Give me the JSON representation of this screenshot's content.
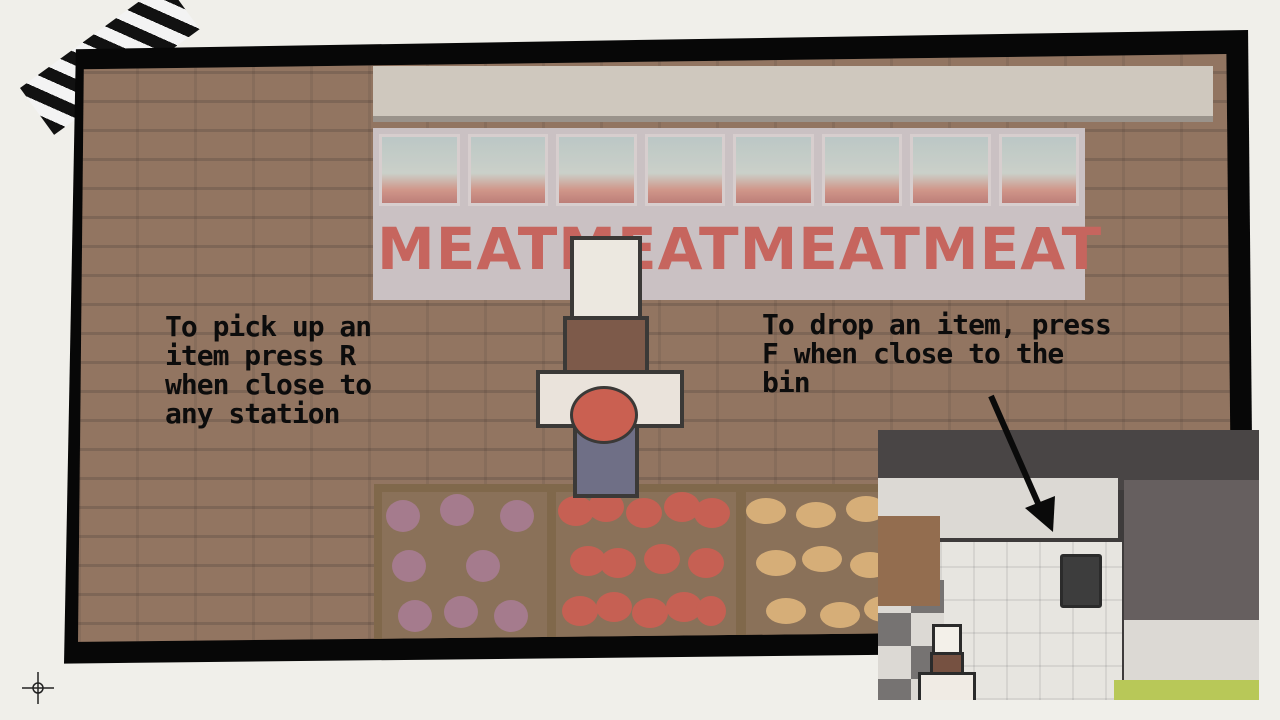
{
  "scene": {
    "store_sign_words": [
      "MEAT",
      "MEAT",
      "MEAT",
      "MEAT"
    ]
  },
  "hints": {
    "pickup": "To pick up an\nitem press R\nwhen close to\nany station",
    "drop": "To drop an item, press\nF when close to the\nbin"
  },
  "colors": {
    "sign_text": "#c4504a",
    "brick": "#84634e",
    "frame": "#070707"
  },
  "icons": {
    "tape": "diagonal-striped-tape",
    "crosshair": "crosshair-icon",
    "arrow": "arrow-down-pointer"
  }
}
